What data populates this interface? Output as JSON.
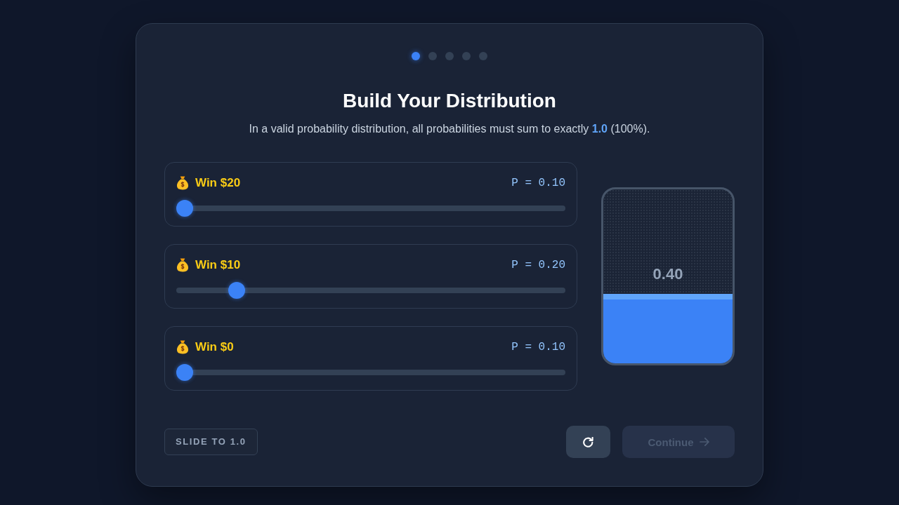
{
  "steps": [
    {
      "selected": true
    },
    {
      "selected": false
    },
    {
      "selected": false
    },
    {
      "selected": false
    },
    {
      "selected": false
    }
  ],
  "title": "Build Your Distribution",
  "subtitle": "In a valid probability distribution, all probabilities must sum to exactly **1.0** (100%).",
  "outcomes": [
    {
      "label": "Win $20",
      "reading": "P = 0.10",
      "level": 0
    },
    {
      "label": "Win $10",
      "reading": "P = 0.20",
      "level": 0.14
    },
    {
      "label": "Win $0",
      "reading": "P = 0.10",
      "level": 0
    }
  ],
  "total": {
    "reading": "0.40",
    "level": 0.4
  },
  "hint": "SLIDE TO 1.0",
  "buttons": [
    {
      "kind": "reset",
      "disabled": false
    },
    {
      "kind": "continue",
      "label": "Continue",
      "disabled": true
    }
  ]
}
